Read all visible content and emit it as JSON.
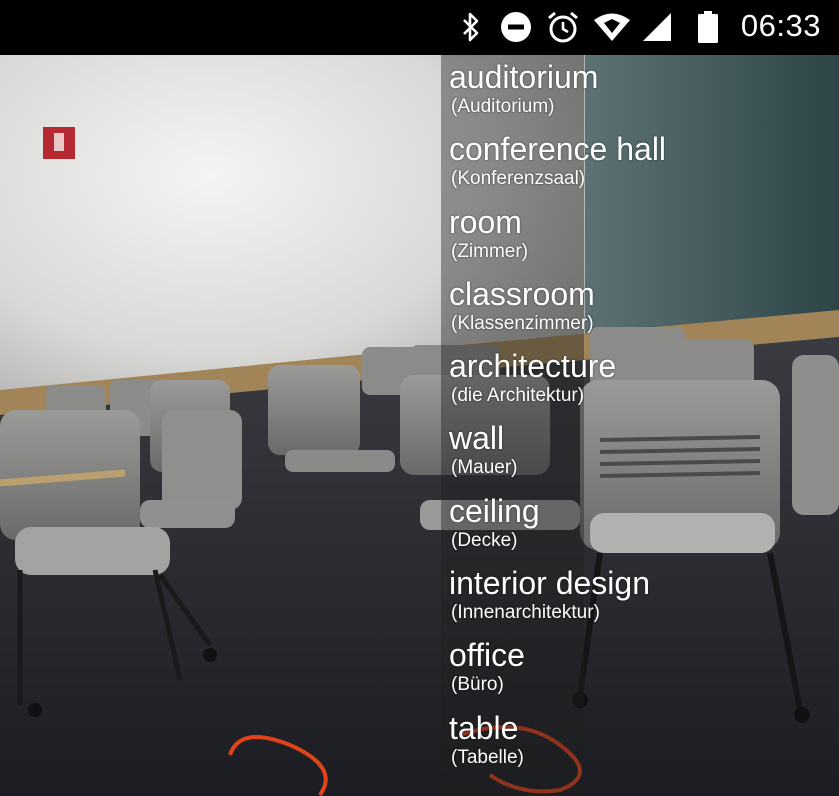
{
  "status_bar": {
    "time": "06:33",
    "icons": [
      "bluetooth-icon",
      "do-not-disturb-icon",
      "alarm-icon",
      "wifi-icon",
      "cell-signal-icon",
      "battery-icon"
    ]
  },
  "labels": [
    {
      "term": "auditorium",
      "translation": "(Auditorium)"
    },
    {
      "term": "conference hall",
      "translation": "(Konferenzsaal)"
    },
    {
      "term": "room",
      "translation": "(Zimmer)"
    },
    {
      "term": "classroom",
      "translation": "(Klassenzimmer)"
    },
    {
      "term": "architecture",
      "translation": "(die Architektur)"
    },
    {
      "term": "wall",
      "translation": "(Mauer)"
    },
    {
      "term": "ceiling",
      "translation": "(Decke)"
    },
    {
      "term": "interior design",
      "translation": "(Innenarchitektur)"
    },
    {
      "term": "office",
      "translation": "(Büro)"
    },
    {
      "term": "table",
      "translation": "(Tabelle)"
    }
  ],
  "colors": {
    "status_bar_bg": "#000000",
    "overlay": "rgba(30,30,30,0.42)",
    "label_text": "#ffffff"
  }
}
